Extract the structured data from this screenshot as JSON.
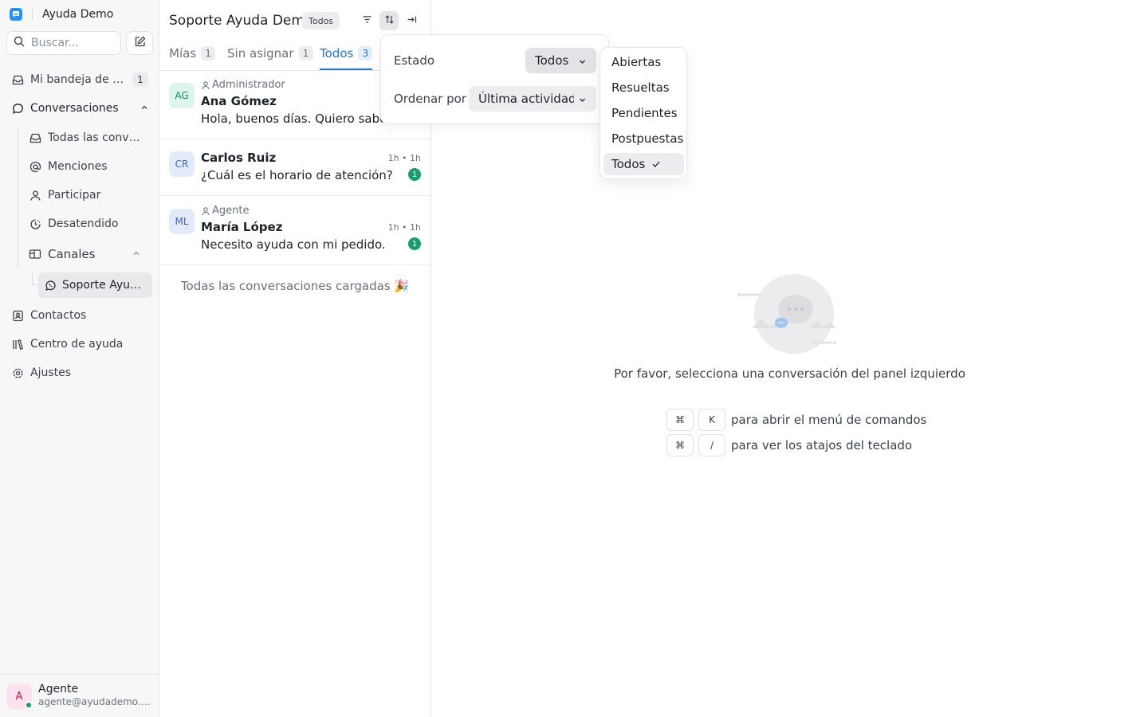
{
  "brand": {
    "name": "Ayuda Demo",
    "logo_icon": "chat-logo-icon",
    "accent": "#1f93ff"
  },
  "search": {
    "placeholder": "Buscar..."
  },
  "sidebar": {
    "inbox": {
      "label": "Mi bandeja de entrada",
      "count": "1"
    },
    "conversations": {
      "label": "Conversaciones"
    },
    "sub_items": [
      {
        "label": "Todas las conversaciones",
        "icon": "inbox-icon"
      },
      {
        "label": "Menciones",
        "icon": "at-icon"
      },
      {
        "label": "Participar",
        "icon": "person-icon"
      },
      {
        "label": "Desatendido",
        "icon": "clock-icon"
      }
    ],
    "channels": {
      "label": "Canales",
      "items": [
        {
          "label": "Soporte Ayuda Demo",
          "icon": "whatsapp-icon"
        }
      ]
    },
    "contacts": {
      "label": "Contactos"
    },
    "help_center": {
      "label": "Centro de ayuda"
    },
    "settings": {
      "label": "Ajustes"
    }
  },
  "user": {
    "initial": "A",
    "name": "Agente",
    "email": "agente@ayudademo.com",
    "status_color": "#14a06e"
  },
  "list": {
    "title": "Soporte Ayuda Demo",
    "status_pill": "Todos",
    "tabs": [
      {
        "label": "Mías",
        "count": "1"
      },
      {
        "label": "Sin asignar",
        "count": "1"
      },
      {
        "label": "Todos",
        "count": "3"
      }
    ],
    "conversations": [
      {
        "initials": "AG",
        "assignee": "Administrador",
        "name": "Ana Gómez",
        "message": "Hola, buenos días. Quiero saber",
        "time": "",
        "unread": ""
      },
      {
        "initials": "CR",
        "assignee": "",
        "name": "Carlos Ruiz",
        "message": "¿Cuál es el horario de atención?",
        "time": "1h • 1h",
        "unread": "1"
      },
      {
        "initials": "ML",
        "assignee": "Agente",
        "name": "María López",
        "message": "Necesito ayuda con mi pedido.",
        "time": "1h • 1h",
        "unread": "1"
      }
    ],
    "all_loaded": "Todas las conversaciones cargadas 🎉"
  },
  "filter_popover": {
    "status_label": "Estado",
    "status_value": "Todos",
    "sort_label": "Ordenar por",
    "sort_value": "Última actividad..."
  },
  "status_dropdown": {
    "options": [
      "Abiertas",
      "Resueltas",
      "Pendientes",
      "Postpuestas",
      "Todos"
    ],
    "selected": "Todos"
  },
  "empty_state": {
    "message": "Por favor, selecciona una conversación del panel izquierdo",
    "shortcuts": [
      {
        "keys": [
          "⌘",
          "K"
        ],
        "text": "para abrir el menú de comandos"
      },
      {
        "keys": [
          "⌘",
          "/"
        ],
        "text": "para ver los atajos del teclado"
      }
    ]
  }
}
